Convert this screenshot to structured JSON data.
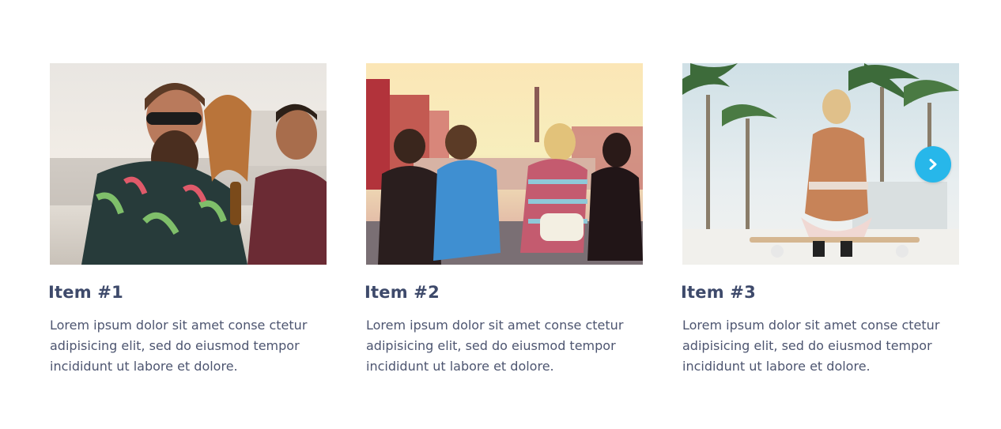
{
  "colors": {
    "title": "#3e4a6b",
    "text": "#4d5570",
    "accent": "#27b7ea"
  },
  "carousel": {
    "items": [
      {
        "title": "Item #1",
        "text": "Lorem ipsum dolor sit amet conse ctetur adipisicing elit, sed do eiusmod tempor incididunt ut labore et dolore.",
        "image": "friends-laughing-on-rooftop-photo"
      },
      {
        "title": "Item #2",
        "text": "Lorem ipsum dolor sit amet conse ctetur adipisicing elit, sed do eiusmod tempor incididunt ut labore et dolore.",
        "image": "friends-sitting-by-river-photo"
      },
      {
        "title": "Item #3",
        "text": "Lorem ipsum dolor sit amet conse ctetur adipisicing elit, sed do eiusmod tempor incididunt ut labore et dolore.",
        "image": "woman-on-skateboard-palms-photo"
      }
    ],
    "next_icon": "chevron-right-icon"
  }
}
